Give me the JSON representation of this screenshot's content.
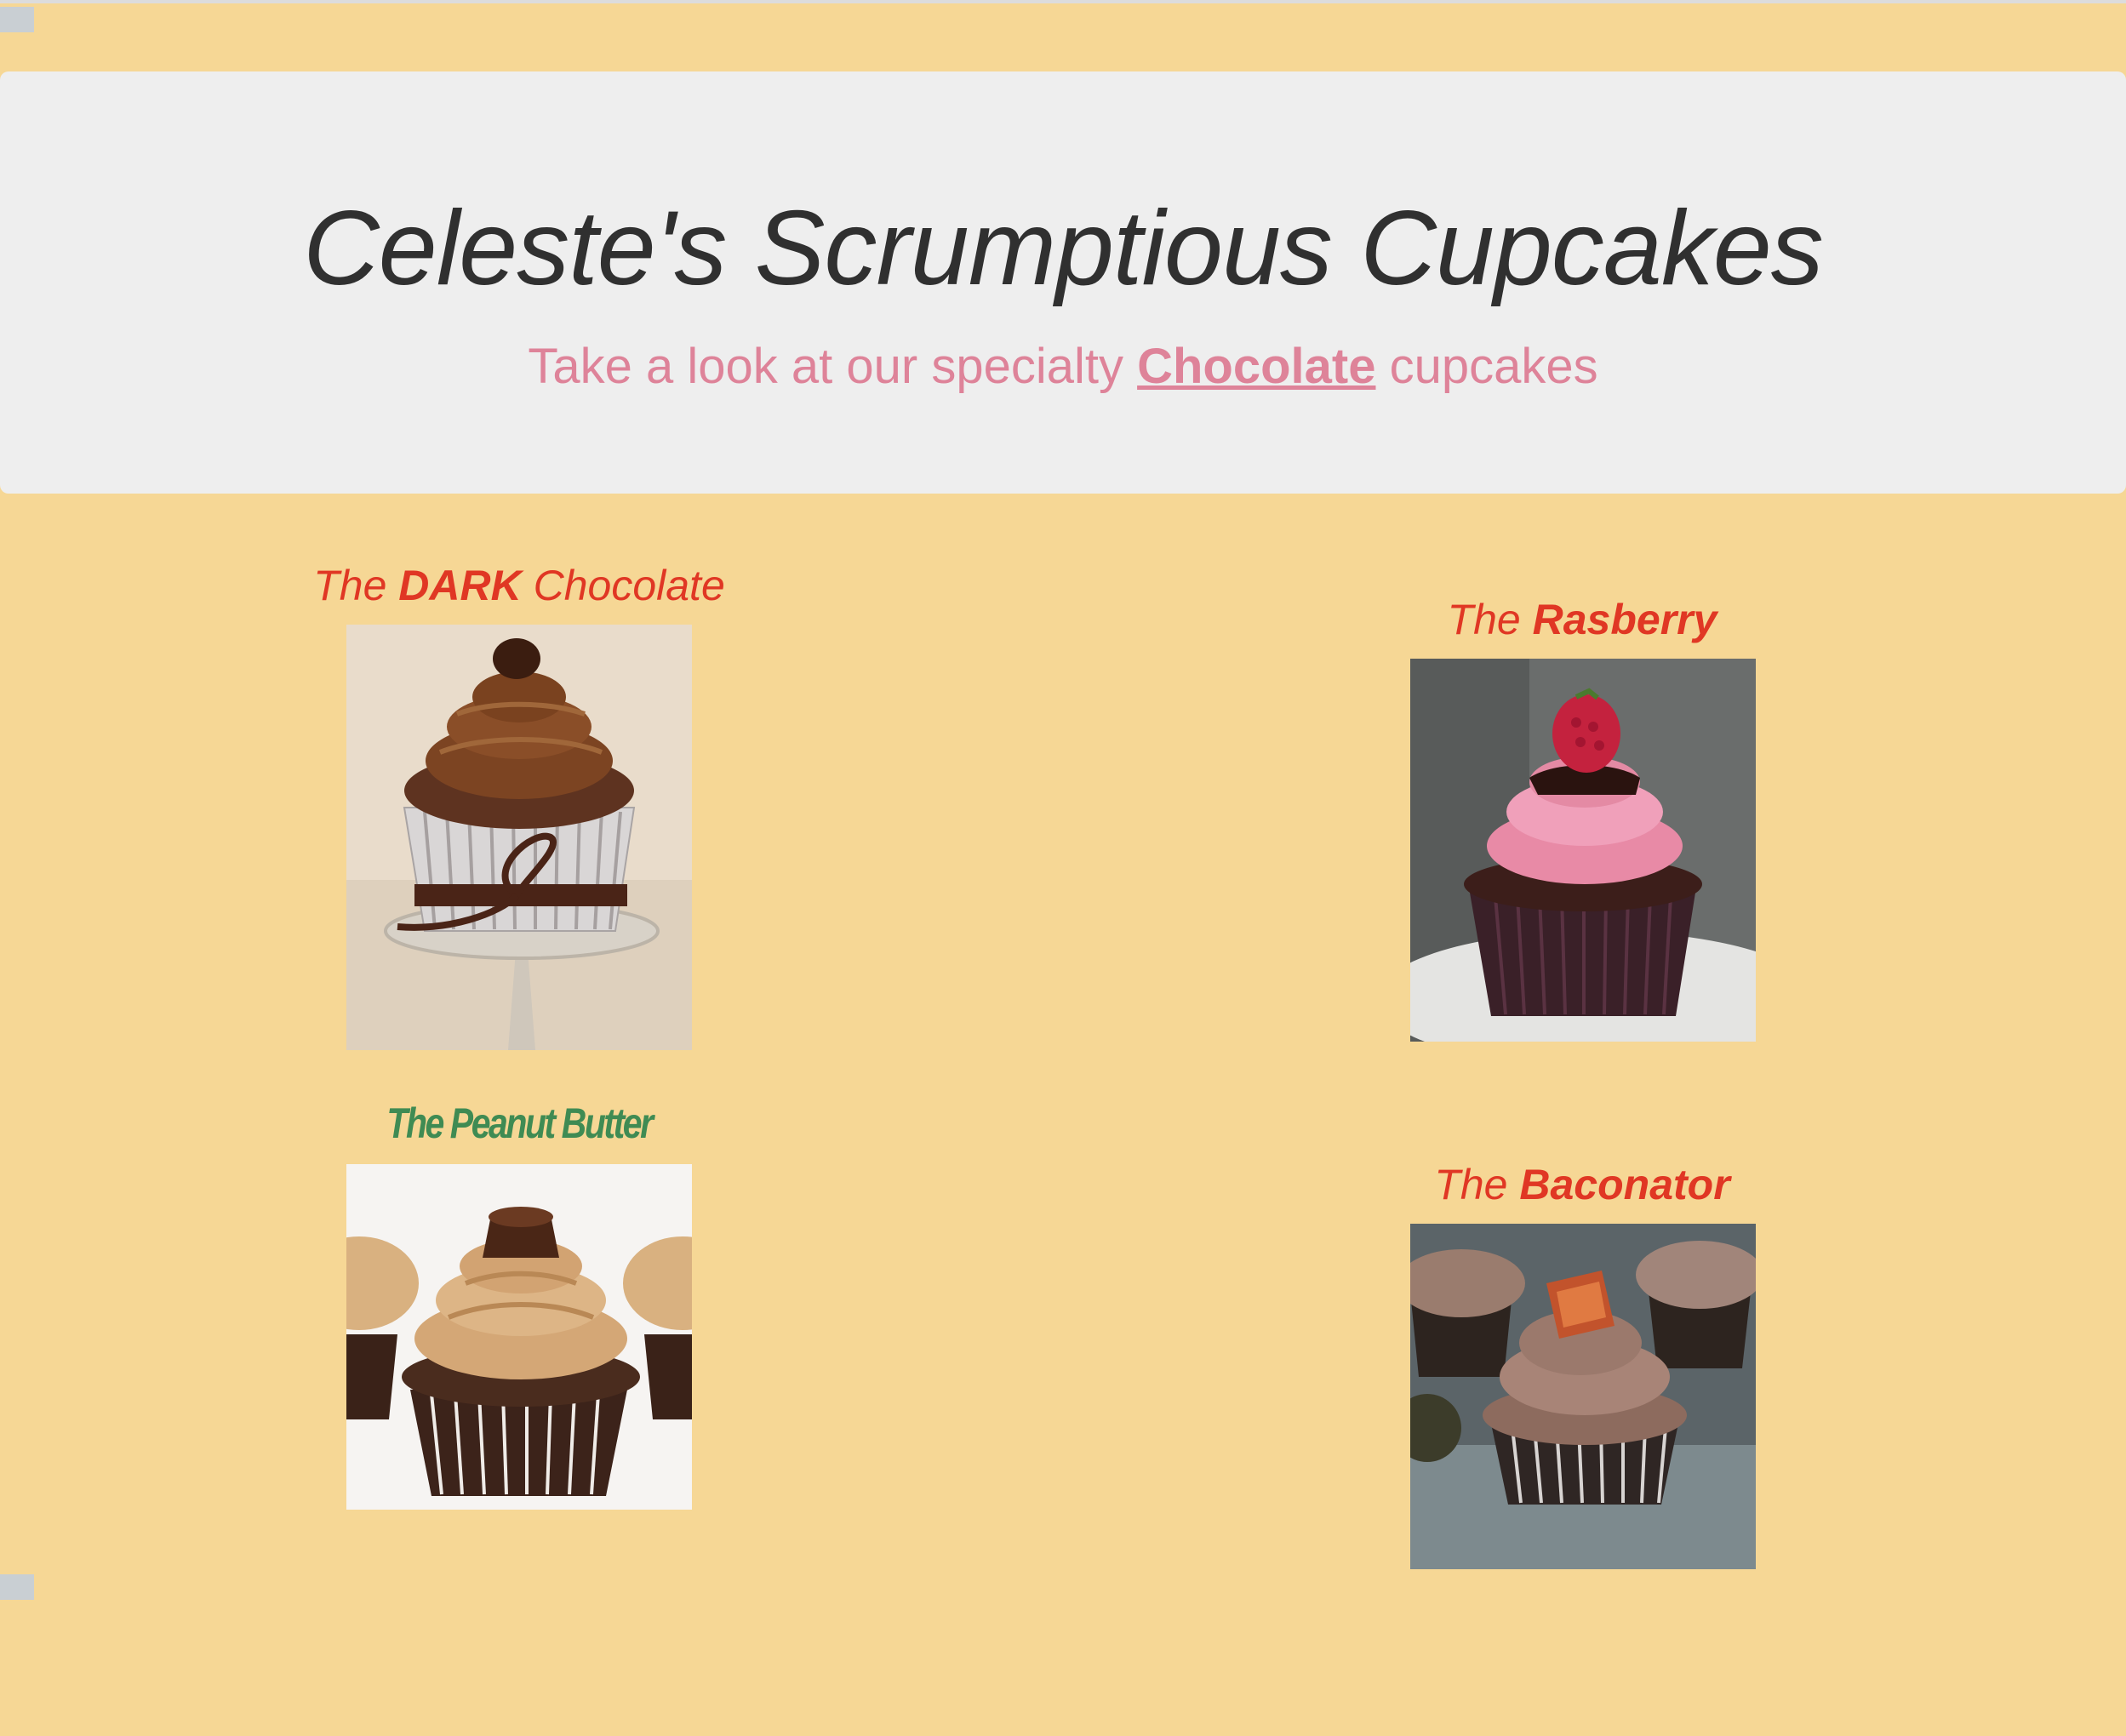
{
  "header": {
    "title": "Celeste's Scrumptious Cupcakes",
    "tagline_before": "Take a look at our specialty ",
    "tagline_link": "Chocolate",
    "tagline_after": " cupcakes"
  },
  "cupcakes": [
    {
      "title_pre": "The ",
      "title_bold": "DARK",
      "title_post": " Chocolate",
      "image": "dark-chocolate-cupcake-photo"
    },
    {
      "title_pre": "The ",
      "title_bold": "Rasberry",
      "title_post": "",
      "image": "raspberry-cupcake-photo"
    },
    {
      "title_pre": "",
      "title_bold": "The Peanut Butter",
      "title_post": "",
      "image": "peanut-butter-cupcake-photo"
    },
    {
      "title_pre": "The ",
      "title_bold": "Baconator",
      "title_post": "",
      "image": "baconator-cupcake-photo"
    }
  ],
  "colors": {
    "page_background": "#f6d795",
    "header_background": "#eeeeee",
    "title_text": "#303030",
    "tagline_text": "#de8399",
    "cake_title_red": "#e03724",
    "cake_title_green": "#3f8b53"
  }
}
